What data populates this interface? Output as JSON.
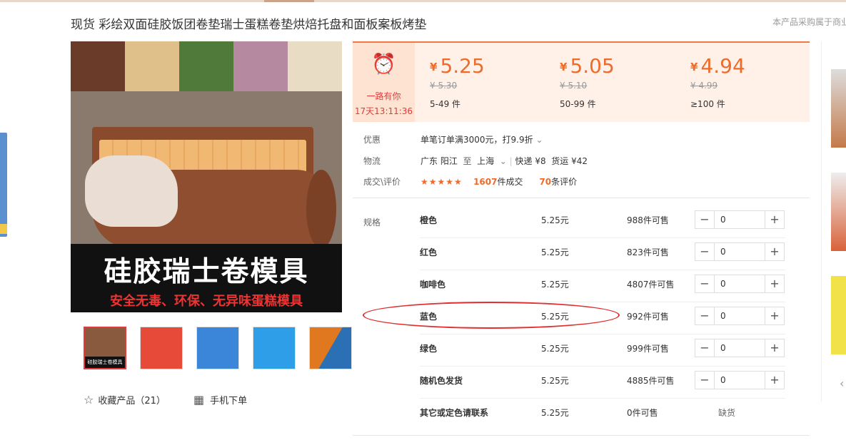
{
  "header": {
    "title": "现货 彩绘双面硅胶饭团卷垫瑞士蛋糕卷垫烘焙托盘和面板案板烤垫",
    "notice": "本产品采购属于商业"
  },
  "gallery": {
    "banner_title": "硅胶瑞士卷模具",
    "banner_subtitle": "安全无毒、环保、无异味蛋糕模具",
    "thumb_banner": "硅胶瑞士卷模具"
  },
  "actions": {
    "favorite_label": "收藏产品（21）",
    "mobile_label": "手机下单"
  },
  "promo": {
    "label": "一路有你",
    "countdown": "17天13:11:36"
  },
  "tiers": [
    {
      "yen": "¥",
      "price": "5.25",
      "old": "¥ 5.30",
      "qty": "5-49 件"
    },
    {
      "yen": "¥",
      "price": "5.05",
      "old": "¥ 5.10",
      "qty": "50-99 件"
    },
    {
      "yen": "¥",
      "price": "4.94",
      "old": "¥ 4.99",
      "qty": "≥100 件"
    }
  ],
  "info": {
    "discount_key": "优惠",
    "discount_value": "单笔订单满3000元，打9.9折",
    "logistics_key": "物流",
    "from": "广东 阳江",
    "to_word": "至",
    "to": "上海",
    "express": "快递 ¥8",
    "freight": "货运 ¥42",
    "deal_key": "成交\\评价",
    "stars": "★★★★★",
    "deals_num": "1607",
    "deals_unit": "件成交",
    "reviews_num": "70",
    "reviews_unit": "条评价"
  },
  "spec_label": "规格",
  "skus": [
    {
      "name": "橙色",
      "price": "5.25元",
      "stock": "988件可售",
      "qty": "0"
    },
    {
      "name": "红色",
      "price": "5.25元",
      "stock": "823件可售",
      "qty": "0"
    },
    {
      "name": "咖啡色",
      "price": "5.25元",
      "stock": "4807件可售",
      "qty": "0"
    },
    {
      "name": "蓝色",
      "price": "5.25元",
      "stock": "992件可售",
      "qty": "0"
    },
    {
      "name": "绿色",
      "price": "5.25元",
      "stock": "999件可售",
      "qty": "0"
    },
    {
      "name": "随机色发货",
      "price": "5.25元",
      "stock": "4885件可售",
      "qty": "0"
    },
    {
      "name": "其它或定色请联系",
      "price": "5.25元",
      "stock": "0件可售",
      "status": "缺货"
    }
  ],
  "colors": {
    "accent": "#f06a2a",
    "highlight": "#e03030",
    "panel_bg": "#fff1e8"
  },
  "icons": [
    "alarm-clock-icon",
    "star-outline-icon",
    "qr-code-icon",
    "chevron-down-icon",
    "minus-icon",
    "plus-icon",
    "chevron-left-icon"
  ]
}
